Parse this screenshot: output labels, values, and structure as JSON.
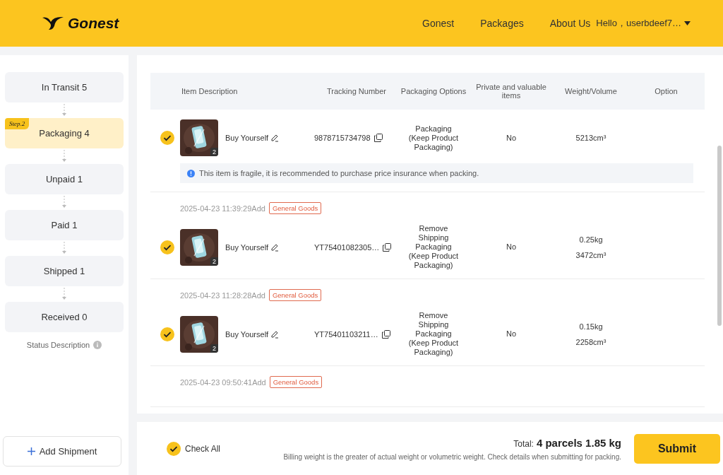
{
  "nav": {
    "brand": "Gonest",
    "links": [
      "Gonest",
      "Packages",
      "About Us"
    ],
    "user": "Hello，userbdeef7…"
  },
  "sidebar": {
    "step_badge": "Step.2",
    "steps": [
      {
        "label": "In Transit 5",
        "selected": false
      },
      {
        "label": "Packaging 4",
        "selected": true
      },
      {
        "label": "Unpaid 1",
        "selected": false
      },
      {
        "label": "Paid 1",
        "selected": false
      },
      {
        "label": "Shipped 1",
        "selected": false
      },
      {
        "label": "Received 0",
        "selected": false
      }
    ],
    "status_description": "Status Description",
    "add_button": "Add Shipment"
  },
  "table": {
    "columns": [
      "Item Description",
      "Tracking Number",
      "Packaging Options",
      "Private and valuable items",
      "Weight/Volume",
      "Option"
    ],
    "rows": [
      {
        "checked": true,
        "qty": "2",
        "description": "Buy Yourself",
        "tracking": "9878715734798",
        "packaging": "Packaging (Keep Product Packaging)",
        "private": "No",
        "volume": "5213cm³",
        "notice": "This item is fragile, it is recommended to purchase price insurance when packing."
      },
      {
        "added": "2025-04-23 11:39:29Add",
        "tag": "General Goods",
        "checked": true,
        "qty": "2",
        "description": "Buy Yourself",
        "tracking": "YT75401082305…",
        "packaging": "Remove Shipping Packaging (Keep Product Packaging)",
        "private": "No",
        "weight": "0.25kg",
        "volume": "3472cm³"
      },
      {
        "added": "2025-04-23 11:28:28Add",
        "tag": "General Goods",
        "checked": true,
        "qty": "2",
        "description": "Buy Yourself",
        "tracking": "YT75401103211…",
        "packaging": "Remove Shipping Packaging (Keep Product Packaging)",
        "private": "No",
        "weight": "0.15kg",
        "volume": "2258cm³"
      },
      {
        "added": "2025-04-23 09:50:41Add",
        "tag": "General Goods"
      }
    ]
  },
  "footer": {
    "check_all": {
      "label": "Check All",
      "checked": true
    },
    "total_label": "Total:",
    "total_value": "4 parcels 1.85 kg",
    "note": "Billing weight is the greater of actual weight or volumetric weight. Check details when submitting for packing.",
    "submit": "Submit"
  }
}
